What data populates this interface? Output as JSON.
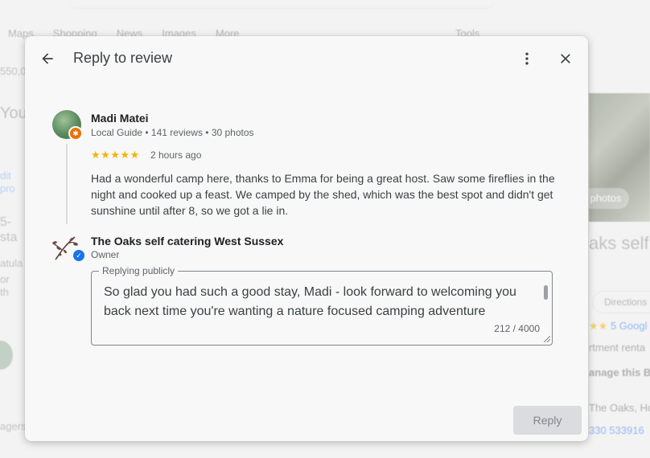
{
  "background": {
    "tabs": [
      "Maps",
      "Shopping",
      "News",
      "Images",
      "More"
    ],
    "tools": "Tools",
    "left_fragments": [
      "550,0",
      "You",
      "dit pro",
      "5-sta",
      "atula",
      "or th",
      "agers"
    ],
    "photos_button": "photos",
    "business_title": "aks self",
    "directions": "Directions",
    "rating": "5 Googl",
    "category": "rtment renta",
    "manage": "anage this B",
    "address": "The Oaks, Ho",
    "phone": "330 533916"
  },
  "dialog": {
    "title": "Reply to review",
    "review": {
      "reviewer_name": "Madi Matei",
      "reviewer_meta": "Local Guide • 141 reviews • 30 photos",
      "stars": "★★★★★",
      "time": "2 hours ago",
      "text": "Had a wonderful camp here, thanks to Emma for being a great host. Saw some fireflies in the night and cooked up a feast. We camped by the shed, which was the best spot and didn't get sunshine until after 8, so we got a lie in."
    },
    "owner": {
      "name": "The Oaks self catering West Sussex",
      "role": "Owner"
    },
    "reply": {
      "label": "Replying publicly",
      "value": "So glad you had such a good stay, Madi - look forward to welcoming you back next time you're wanting a nature focused camping adventure",
      "char_count": "212 / 4000"
    },
    "reply_button": "Reply"
  },
  "colors": {
    "star": "#f4b400",
    "local_guide_badge": "#e8710a",
    "verified_badge": "#1a73e8",
    "disabled_button": "#dadce0"
  }
}
